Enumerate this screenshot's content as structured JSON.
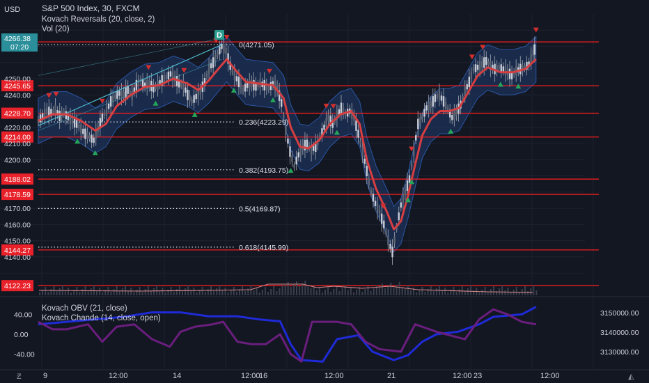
{
  "header": {
    "currency": "USD",
    "title": "S&P 500 Index, 30, FXCM",
    "indicator1": "Kovach Reversals (20, close, 2)",
    "indicator2": "Vol (20)"
  },
  "colors": {
    "background": "#131722",
    "grid": "#1e2230",
    "text": "#d1d4dc",
    "hline": "#f01e1e",
    "price_candle": "#8a919e",
    "ma_line": "#d63f42",
    "band_fill": "#1f3a6b",
    "trend": "#4fb8c9",
    "obv": "#1f2bd8",
    "chande": "#6a1e7d",
    "buy": "#26a65b",
    "sell": "#d32f2f",
    "fib": "#e0e3eb"
  },
  "price_axis": {
    "ticks": [
      "4250.00",
      "4240.00",
      "4220.00",
      "4210.00",
      "4200.00",
      "4170.00",
      "4160.00",
      "4150.00",
      "4140.00"
    ],
    "current_price": "4266.38",
    "countdown": "07:20"
  },
  "level_labels": [
    "4272.71",
    "4245.65",
    "4228.70",
    "4214.00",
    "4188.02",
    "4178.59",
    "4144.27",
    "4122.23"
  ],
  "fib_labels": [
    "0(4271.05)",
    "0.236(4223.29)",
    "0.382(4193.75)",
    "0.5(4169.87)",
    "0.618(4145.99)"
  ],
  "lower_pane": {
    "title1": "Kovach OBV (21, close)",
    "title2": "Kovach Chande (14, close, open)",
    "left_ticks": [
      "40.00",
      "0.00",
      "-40.00"
    ],
    "right_ticks": [
      "3150000.00",
      "3140000.00",
      "3130000.00"
    ]
  },
  "time_axis": [
    "9",
    "12:00",
    "14",
    "12:00",
    "16",
    "12:00",
    "21",
    "12:00",
    "23",
    "12:00"
  ],
  "marker_letter": "D",
  "chart_data": {
    "type": "line",
    "title": "S&P 500 Index, 30, FXCM",
    "x": [
      "9",
      "12:00",
      "14",
      "12:00",
      "16",
      "12:00",
      "21",
      "12:00",
      "23",
      "12:00"
    ],
    "ylim": [
      4118,
      4290
    ],
    "price_series": [
      {
        "x": 0,
        "y": 4224
      },
      {
        "x": 6,
        "y": 4227
      },
      {
        "x": 12,
        "y": 4230
      },
      {
        "x": 18,
        "y": 4229
      },
      {
        "x": 24,
        "y": 4231
      },
      {
        "x": 30,
        "y": 4227
      },
      {
        "x": 36,
        "y": 4229
      },
      {
        "x": 42,
        "y": 4226
      },
      {
        "x": 48,
        "y": 4224
      },
      {
        "x": 54,
        "y": 4222
      },
      {
        "x": 60,
        "y": 4219
      },
      {
        "x": 66,
        "y": 4216
      },
      {
        "x": 72,
        "y": 4214
      },
      {
        "x": 78,
        "y": 4212
      },
      {
        "x": 84,
        "y": 4219
      },
      {
        "x": 90,
        "y": 4226
      },
      {
        "x": 96,
        "y": 4230
      },
      {
        "x": 102,
        "y": 4236
      },
      {
        "x": 108,
        "y": 4239
      },
      {
        "x": 114,
        "y": 4241
      },
      {
        "x": 120,
        "y": 4240
      },
      {
        "x": 126,
        "y": 4243
      },
      {
        "x": 132,
        "y": 4240
      },
      {
        "x": 138,
        "y": 4246
      },
      {
        "x": 144,
        "y": 4249
      },
      {
        "x": 150,
        "y": 4246
      },
      {
        "x": 156,
        "y": 4247
      },
      {
        "x": 162,
        "y": 4244
      },
      {
        "x": 168,
        "y": 4246
      },
      {
        "x": 174,
        "y": 4249
      },
      {
        "x": 180,
        "y": 4251
      },
      {
        "x": 186,
        "y": 4253
      },
      {
        "x": 192,
        "y": 4250
      },
      {
        "x": 198,
        "y": 4247
      },
      {
        "x": 204,
        "y": 4246
      },
      {
        "x": 210,
        "y": 4240
      },
      {
        "x": 216,
        "y": 4236
      },
      {
        "x": 222,
        "y": 4239
      },
      {
        "x": 228,
        "y": 4242
      },
      {
        "x": 234,
        "y": 4248
      },
      {
        "x": 240,
        "y": 4256
      },
      {
        "x": 246,
        "y": 4260
      },
      {
        "x": 252,
        "y": 4265
      },
      {
        "x": 258,
        "y": 4270
      },
      {
        "x": 264,
        "y": 4267
      },
      {
        "x": 270,
        "y": 4258
      },
      {
        "x": 276,
        "y": 4252
      },
      {
        "x": 282,
        "y": 4248
      },
      {
        "x": 288,
        "y": 4243
      },
      {
        "x": 294,
        "y": 4246
      },
      {
        "x": 300,
        "y": 4247
      },
      {
        "x": 306,
        "y": 4245
      },
      {
        "x": 312,
        "y": 4247
      },
      {
        "x": 318,
        "y": 4246
      },
      {
        "x": 324,
        "y": 4244
      },
      {
        "x": 330,
        "y": 4247
      },
      {
        "x": 336,
        "y": 4244
      },
      {
        "x": 342,
        "y": 4235
      },
      {
        "x": 348,
        "y": 4218
      },
      {
        "x": 354,
        "y": 4205
      },
      {
        "x": 360,
        "y": 4196
      },
      {
        "x": 366,
        "y": 4203
      },
      {
        "x": 372,
        "y": 4208
      },
      {
        "x": 378,
        "y": 4210
      },
      {
        "x": 384,
        "y": 4206
      },
      {
        "x": 390,
        "y": 4208
      },
      {
        "x": 396,
        "y": 4214
      },
      {
        "x": 402,
        "y": 4220
      },
      {
        "x": 408,
        "y": 4226
      },
      {
        "x": 414,
        "y": 4222
      },
      {
        "x": 420,
        "y": 4227
      },
      {
        "x": 426,
        "y": 4232
      },
      {
        "x": 432,
        "y": 4228
      },
      {
        "x": 438,
        "y": 4230
      },
      {
        "x": 444,
        "y": 4226
      },
      {
        "x": 450,
        "y": 4216
      },
      {
        "x": 456,
        "y": 4205
      },
      {
        "x": 462,
        "y": 4193
      },
      {
        "x": 468,
        "y": 4180
      },
      {
        "x": 474,
        "y": 4173
      },
      {
        "x": 480,
        "y": 4167
      },
      {
        "x": 486,
        "y": 4160
      },
      {
        "x": 492,
        "y": 4150
      },
      {
        "x": 498,
        "y": 4143
      },
      {
        "x": 504,
        "y": 4158
      },
      {
        "x": 510,
        "y": 4172
      },
      {
        "x": 516,
        "y": 4180
      },
      {
        "x": 522,
        "y": 4188
      },
      {
        "x": 528,
        "y": 4205
      },
      {
        "x": 534,
        "y": 4222
      },
      {
        "x": 540,
        "y": 4226
      },
      {
        "x": 546,
        "y": 4232
      },
      {
        "x": 552,
        "y": 4234
      },
      {
        "x": 558,
        "y": 4238
      },
      {
        "x": 564,
        "y": 4240
      },
      {
        "x": 570,
        "y": 4236
      },
      {
        "x": 576,
        "y": 4231
      },
      {
        "x": 582,
        "y": 4226
      },
      {
        "x": 588,
        "y": 4229
      },
      {
        "x": 594,
        "y": 4234
      },
      {
        "x": 600,
        "y": 4242
      },
      {
        "x": 606,
        "y": 4248
      },
      {
        "x": 612,
        "y": 4256
      },
      {
        "x": 618,
        "y": 4257
      },
      {
        "x": 624,
        "y": 4259
      },
      {
        "x": 630,
        "y": 4261
      },
      {
        "x": 636,
        "y": 4258
      },
      {
        "x": 642,
        "y": 4256
      },
      {
        "x": 648,
        "y": 4257
      },
      {
        "x": 654,
        "y": 4256
      },
      {
        "x": 660,
        "y": 4254
      },
      {
        "x": 666,
        "y": 4252
      },
      {
        "x": 672,
        "y": 4255
      },
      {
        "x": 678,
        "y": 4256
      },
      {
        "x": 684,
        "y": 4257
      },
      {
        "x": 690,
        "y": 4259
      },
      {
        "x": 696,
        "y": 4266
      },
      {
        "x": 700,
        "y": 4270
      }
    ],
    "ma_series": [
      {
        "x": 0,
        "y": 4224
      },
      {
        "x": 20,
        "y": 4228
      },
      {
        "x": 40,
        "y": 4228
      },
      {
        "x": 60,
        "y": 4224
      },
      {
        "x": 80,
        "y": 4218
      },
      {
        "x": 95,
        "y": 4222
      },
      {
        "x": 110,
        "y": 4233
      },
      {
        "x": 130,
        "y": 4240
      },
      {
        "x": 150,
        "y": 4245
      },
      {
        "x": 170,
        "y": 4246
      },
      {
        "x": 190,
        "y": 4250
      },
      {
        "x": 210,
        "y": 4247
      },
      {
        "x": 225,
        "y": 4243
      },
      {
        "x": 240,
        "y": 4249
      },
      {
        "x": 255,
        "y": 4257
      },
      {
        "x": 265,
        "y": 4262
      },
      {
        "x": 278,
        "y": 4255
      },
      {
        "x": 292,
        "y": 4248
      },
      {
        "x": 310,
        "y": 4247
      },
      {
        "x": 330,
        "y": 4246
      },
      {
        "x": 345,
        "y": 4238
      },
      {
        "x": 355,
        "y": 4220
      },
      {
        "x": 368,
        "y": 4208
      },
      {
        "x": 380,
        "y": 4207
      },
      {
        "x": 395,
        "y": 4212
      },
      {
        "x": 410,
        "y": 4222
      },
      {
        "x": 425,
        "y": 4228
      },
      {
        "x": 440,
        "y": 4230
      },
      {
        "x": 452,
        "y": 4222
      },
      {
        "x": 462,
        "y": 4200
      },
      {
        "x": 475,
        "y": 4182
      },
      {
        "x": 490,
        "y": 4168
      },
      {
        "x": 500,
        "y": 4157
      },
      {
        "x": 510,
        "y": 4162
      },
      {
        "x": 520,
        "y": 4178
      },
      {
        "x": 530,
        "y": 4197
      },
      {
        "x": 540,
        "y": 4215
      },
      {
        "x": 552,
        "y": 4225
      },
      {
        "x": 565,
        "y": 4230
      },
      {
        "x": 578,
        "y": 4230
      },
      {
        "x": 592,
        "y": 4232
      },
      {
        "x": 605,
        "y": 4242
      },
      {
        "x": 618,
        "y": 4252
      },
      {
        "x": 632,
        "y": 4257
      },
      {
        "x": 650,
        "y": 4254
      },
      {
        "x": 668,
        "y": 4254
      },
      {
        "x": 685,
        "y": 4256
      },
      {
        "x": 700,
        "y": 4262
      }
    ],
    "horizontal_levels": [
      4272.71,
      4245.65,
      4228.7,
      4214.0,
      4188.02,
      4178.59,
      4144.27,
      4122.23
    ],
    "fibonacci": [
      {
        "ratio": "0",
        "value": 4271.05
      },
      {
        "ratio": "0.236",
        "value": 4223.29
      },
      {
        "ratio": "0.382",
        "value": 4193.75
      },
      {
        "ratio": "0.5",
        "value": 4169.87
      },
      {
        "ratio": "0.618",
        "value": 4145.99
      }
    ],
    "buy_signals": [
      55,
      80,
      165,
      220,
      275,
      330,
      355,
      420,
      525,
      520,
      580,
      650,
      675
    ],
    "sell_signals": [
      15,
      25,
      90,
      155,
      205,
      250,
      265,
      325,
      405,
      415,
      485,
      525,
      610,
      625,
      700
    ],
    "obv_series": [
      {
        "x": 0,
        "y": 20
      },
      {
        "x": 40,
        "y": 25
      },
      {
        "x": 80,
        "y": 30
      },
      {
        "x": 120,
        "y": 35
      },
      {
        "x": 160,
        "y": 44
      },
      {
        "x": 200,
        "y": 44
      },
      {
        "x": 240,
        "y": 36
      },
      {
        "x": 280,
        "y": 36
      },
      {
        "x": 310,
        "y": 30
      },
      {
        "x": 340,
        "y": 26
      },
      {
        "x": 355,
        "y": -20
      },
      {
        "x": 370,
        "y": -52
      },
      {
        "x": 400,
        "y": -55
      },
      {
        "x": 420,
        "y": -10
      },
      {
        "x": 450,
        "y": -2
      },
      {
        "x": 470,
        "y": -35
      },
      {
        "x": 500,
        "y": -52
      },
      {
        "x": 520,
        "y": -42
      },
      {
        "x": 540,
        "y": -15
      },
      {
        "x": 560,
        "y": 0
      },
      {
        "x": 590,
        "y": 5
      },
      {
        "x": 620,
        "y": 20
      },
      {
        "x": 640,
        "y": 35
      },
      {
        "x": 680,
        "y": 40
      },
      {
        "x": 700,
        "y": 55
      }
    ],
    "chande_series": [
      {
        "x": 0,
        "y": 25
      },
      {
        "x": 20,
        "y": 10
      },
      {
        "x": 40,
        "y": 10
      },
      {
        "x": 70,
        "y": 20
      },
      {
        "x": 90,
        "y": -15
      },
      {
        "x": 110,
        "y": 15
      },
      {
        "x": 135,
        "y": 20
      },
      {
        "x": 160,
        "y": -10
      },
      {
        "x": 185,
        "y": -25
      },
      {
        "x": 200,
        "y": 5
      },
      {
        "x": 220,
        "y": 15
      },
      {
        "x": 245,
        "y": 20
      },
      {
        "x": 260,
        "y": 25
      },
      {
        "x": 280,
        "y": -15
      },
      {
        "x": 300,
        "y": -20
      },
      {
        "x": 320,
        "y": -20
      },
      {
        "x": 340,
        "y": 0
      },
      {
        "x": 355,
        "y": -40
      },
      {
        "x": 370,
        "y": -55
      },
      {
        "x": 385,
        "y": 25
      },
      {
        "x": 420,
        "y": 25
      },
      {
        "x": 440,
        "y": 20
      },
      {
        "x": 460,
        "y": -15
      },
      {
        "x": 480,
        "y": -30
      },
      {
        "x": 510,
        "y": -35
      },
      {
        "x": 530,
        "y": 20
      },
      {
        "x": 560,
        "y": 5
      },
      {
        "x": 600,
        "y": -10
      },
      {
        "x": 620,
        "y": 30
      },
      {
        "x": 640,
        "y": 50
      },
      {
        "x": 660,
        "y": 40
      },
      {
        "x": 680,
        "y": 25
      },
      {
        "x": 700,
        "y": 20
      }
    ]
  }
}
